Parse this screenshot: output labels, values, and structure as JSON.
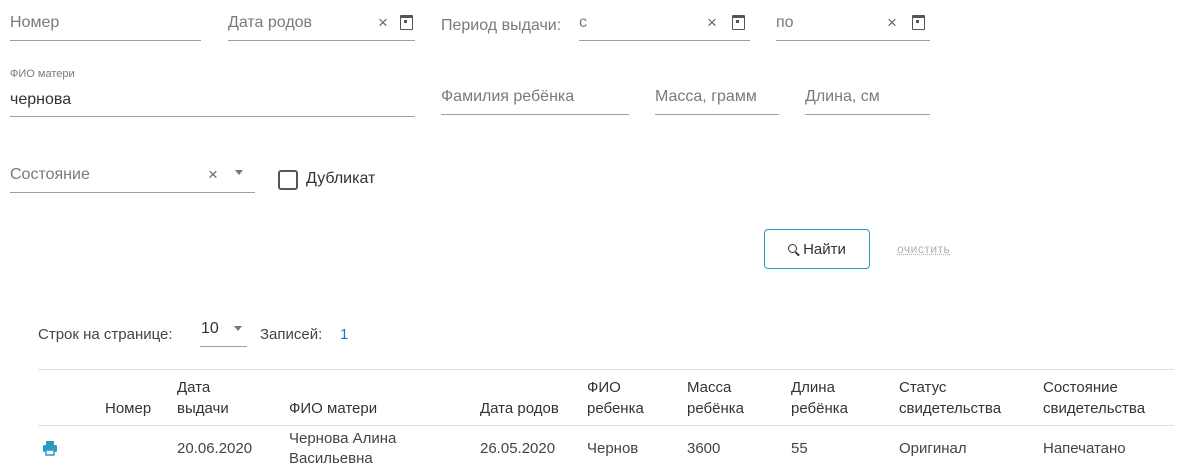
{
  "filters": {
    "number": {
      "placeholder": "Номер"
    },
    "birth_date": {
      "placeholder": "Дата родов"
    },
    "issue_period": {
      "label": "Период выдачи:",
      "from_placeholder": "с",
      "to_placeholder": "по"
    },
    "mother_name": {
      "label": "ФИО матери",
      "value": "чернова"
    },
    "child_surname": {
      "placeholder": "Фамилия ребёнка"
    },
    "mass": {
      "placeholder": "Масса, грамм"
    },
    "length": {
      "placeholder": "Длина, см"
    },
    "state": {
      "placeholder": "Состояние"
    },
    "duplicate": {
      "label": "Дубликат",
      "checked": false
    }
  },
  "actions": {
    "find_label": "Найти",
    "clear_label": "очистить"
  },
  "pagination": {
    "rows_label": "Строк на странице:",
    "rows_value": "10",
    "records_label": "Записей:",
    "records_count": "1"
  },
  "table": {
    "headers": {
      "number": "Номер",
      "issue_date": [
        "Дата",
        "выдачи"
      ],
      "mother": "ФИО матери",
      "birth_date": "Дата родов",
      "child": [
        "ФИО",
        "ребенка"
      ],
      "mass": [
        "Масса",
        "ребёнка"
      ],
      "length": [
        "Длина",
        "ребёнка"
      ],
      "status": [
        "Статус",
        "свидетельства"
      ],
      "state": [
        "Состояние",
        "свидетельства"
      ]
    },
    "rows": [
      {
        "number": "",
        "issue_date": "20.06.2020",
        "mother": [
          "Чернова Алина",
          "Васильевна"
        ],
        "birth_date": "26.05.2020",
        "child": "Чернов",
        "mass": "3600",
        "length": "55",
        "status": "Оригинал",
        "state": "Напечатано"
      }
    ]
  },
  "colors": {
    "accent": "#2a9cc0",
    "link": "#1a73c0",
    "print_icon": "#2a9cc0"
  },
  "icons": {
    "clear": "close-icon",
    "calendar": "calendar-icon",
    "dropdown": "chevron-down-icon",
    "print": "printer-icon",
    "search": "search-icon"
  }
}
